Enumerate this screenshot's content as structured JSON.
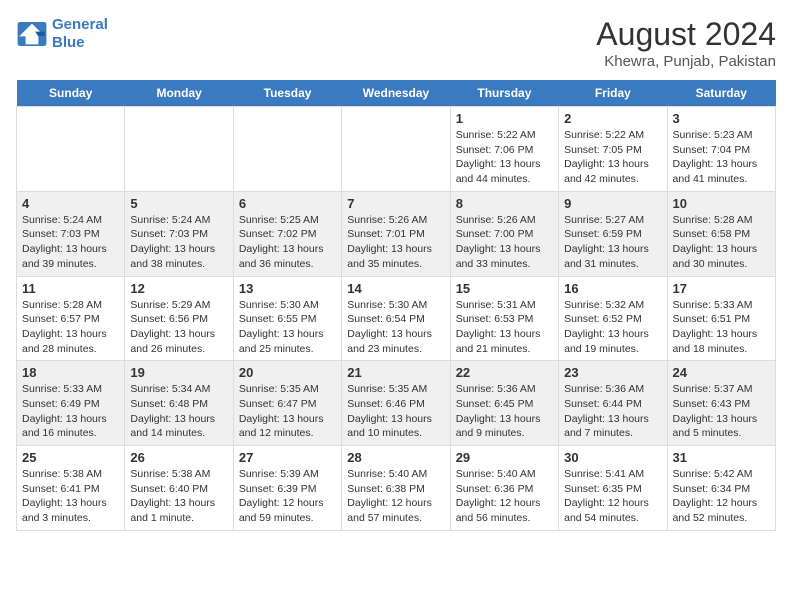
{
  "header": {
    "logo_line1": "General",
    "logo_line2": "Blue",
    "title": "August 2024",
    "subtitle": "Khewra, Punjab, Pakistan"
  },
  "days_of_week": [
    "Sunday",
    "Monday",
    "Tuesday",
    "Wednesday",
    "Thursday",
    "Friday",
    "Saturday"
  ],
  "weeks": [
    [
      {
        "day": "",
        "info": ""
      },
      {
        "day": "",
        "info": ""
      },
      {
        "day": "",
        "info": ""
      },
      {
        "day": "",
        "info": ""
      },
      {
        "day": "1",
        "info": "Sunrise: 5:22 AM\nSunset: 7:06 PM\nDaylight: 13 hours\nand 44 minutes."
      },
      {
        "day": "2",
        "info": "Sunrise: 5:22 AM\nSunset: 7:05 PM\nDaylight: 13 hours\nand 42 minutes."
      },
      {
        "day": "3",
        "info": "Sunrise: 5:23 AM\nSunset: 7:04 PM\nDaylight: 13 hours\nand 41 minutes."
      }
    ],
    [
      {
        "day": "4",
        "info": "Sunrise: 5:24 AM\nSunset: 7:03 PM\nDaylight: 13 hours\nand 39 minutes."
      },
      {
        "day": "5",
        "info": "Sunrise: 5:24 AM\nSunset: 7:03 PM\nDaylight: 13 hours\nand 38 minutes."
      },
      {
        "day": "6",
        "info": "Sunrise: 5:25 AM\nSunset: 7:02 PM\nDaylight: 13 hours\nand 36 minutes."
      },
      {
        "day": "7",
        "info": "Sunrise: 5:26 AM\nSunset: 7:01 PM\nDaylight: 13 hours\nand 35 minutes."
      },
      {
        "day": "8",
        "info": "Sunrise: 5:26 AM\nSunset: 7:00 PM\nDaylight: 13 hours\nand 33 minutes."
      },
      {
        "day": "9",
        "info": "Sunrise: 5:27 AM\nSunset: 6:59 PM\nDaylight: 13 hours\nand 31 minutes."
      },
      {
        "day": "10",
        "info": "Sunrise: 5:28 AM\nSunset: 6:58 PM\nDaylight: 13 hours\nand 30 minutes."
      }
    ],
    [
      {
        "day": "11",
        "info": "Sunrise: 5:28 AM\nSunset: 6:57 PM\nDaylight: 13 hours\nand 28 minutes."
      },
      {
        "day": "12",
        "info": "Sunrise: 5:29 AM\nSunset: 6:56 PM\nDaylight: 13 hours\nand 26 minutes."
      },
      {
        "day": "13",
        "info": "Sunrise: 5:30 AM\nSunset: 6:55 PM\nDaylight: 13 hours\nand 25 minutes."
      },
      {
        "day": "14",
        "info": "Sunrise: 5:30 AM\nSunset: 6:54 PM\nDaylight: 13 hours\nand 23 minutes."
      },
      {
        "day": "15",
        "info": "Sunrise: 5:31 AM\nSunset: 6:53 PM\nDaylight: 13 hours\nand 21 minutes."
      },
      {
        "day": "16",
        "info": "Sunrise: 5:32 AM\nSunset: 6:52 PM\nDaylight: 13 hours\nand 19 minutes."
      },
      {
        "day": "17",
        "info": "Sunrise: 5:33 AM\nSunset: 6:51 PM\nDaylight: 13 hours\nand 18 minutes."
      }
    ],
    [
      {
        "day": "18",
        "info": "Sunrise: 5:33 AM\nSunset: 6:49 PM\nDaylight: 13 hours\nand 16 minutes."
      },
      {
        "day": "19",
        "info": "Sunrise: 5:34 AM\nSunset: 6:48 PM\nDaylight: 13 hours\nand 14 minutes."
      },
      {
        "day": "20",
        "info": "Sunrise: 5:35 AM\nSunset: 6:47 PM\nDaylight: 13 hours\nand 12 minutes."
      },
      {
        "day": "21",
        "info": "Sunrise: 5:35 AM\nSunset: 6:46 PM\nDaylight: 13 hours\nand 10 minutes."
      },
      {
        "day": "22",
        "info": "Sunrise: 5:36 AM\nSunset: 6:45 PM\nDaylight: 13 hours\nand 9 minutes."
      },
      {
        "day": "23",
        "info": "Sunrise: 5:36 AM\nSunset: 6:44 PM\nDaylight: 13 hours\nand 7 minutes."
      },
      {
        "day": "24",
        "info": "Sunrise: 5:37 AM\nSunset: 6:43 PM\nDaylight: 13 hours\nand 5 minutes."
      }
    ],
    [
      {
        "day": "25",
        "info": "Sunrise: 5:38 AM\nSunset: 6:41 PM\nDaylight: 13 hours\nand 3 minutes."
      },
      {
        "day": "26",
        "info": "Sunrise: 5:38 AM\nSunset: 6:40 PM\nDaylight: 13 hours\nand 1 minute."
      },
      {
        "day": "27",
        "info": "Sunrise: 5:39 AM\nSunset: 6:39 PM\nDaylight: 12 hours\nand 59 minutes."
      },
      {
        "day": "28",
        "info": "Sunrise: 5:40 AM\nSunset: 6:38 PM\nDaylight: 12 hours\nand 57 minutes."
      },
      {
        "day": "29",
        "info": "Sunrise: 5:40 AM\nSunset: 6:36 PM\nDaylight: 12 hours\nand 56 minutes."
      },
      {
        "day": "30",
        "info": "Sunrise: 5:41 AM\nSunset: 6:35 PM\nDaylight: 12 hours\nand 54 minutes."
      },
      {
        "day": "31",
        "info": "Sunrise: 5:42 AM\nSunset: 6:34 PM\nDaylight: 12 hours\nand 52 minutes."
      }
    ]
  ]
}
